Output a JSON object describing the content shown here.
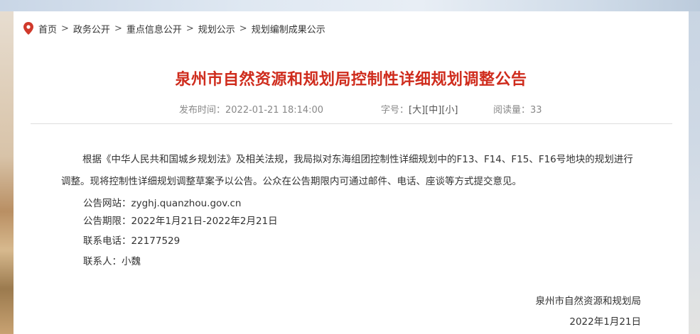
{
  "breadcrumb": {
    "items": [
      "首页",
      "政务公开",
      "重点信息公开",
      "规划公示",
      "规划编制成果公示"
    ],
    "separator": ">"
  },
  "article": {
    "title": "泉州市自然资源和规划局控制性详细规划调整公告",
    "publish_time": "发布时间：2022-01-21 18:14:00",
    "font_size_label": "字号：",
    "font_size_options": [
      "[大]",
      "[中]",
      "[小]"
    ],
    "views": "阅读量：33",
    "paragraph": "根据《中华人民共和国城乡规划法》及相关法规，我局拟对东海组团控制性详细规划中的F13、F14、F15、F16号地块的规划进行调整。现将控制性详细规划调整草案予以公告。公众在公告期限内可通过邮件、电话、座谈等方式提交意见。",
    "lines": [
      "公告网站：zyghj.quanzhou.gov.cn",
      "公告期限：2022年1月21日-2022年2月21日",
      "联系电话：22177529",
      "联系人：小魏"
    ],
    "signature": "泉州市自然资源和规划局",
    "date": "2022年1月21日"
  },
  "colors": {
    "title": "#cf2c1d",
    "pin_icon": "#d0392b"
  },
  "icons": {
    "location": "map-pin-icon"
  }
}
